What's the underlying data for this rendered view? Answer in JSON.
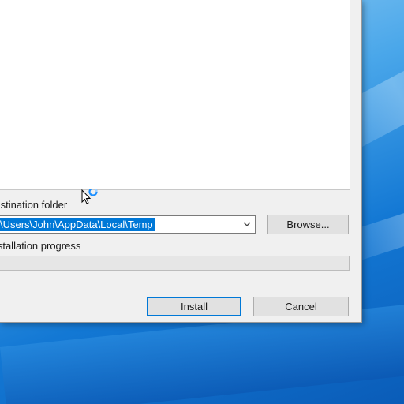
{
  "installer": {
    "destination_label": "Destination folder",
    "destination_path": "C:\\Users\\John\\AppData\\Local\\Temp",
    "browse_label": "Browse...",
    "progress_label": "Installation progress",
    "progress_value": 0,
    "install_label": "Install",
    "cancel_label": "Cancel"
  },
  "cursor": {
    "icon": "busy-arrow-cursor-icon"
  },
  "colors": {
    "selection": "#0078d7",
    "accent": "#0078d7"
  }
}
